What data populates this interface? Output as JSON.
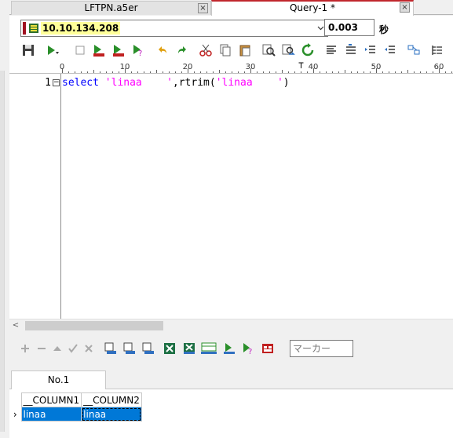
{
  "doc_tabs": [
    {
      "label": "LFTPN.a5er",
      "close": "×"
    },
    {
      "label": "Query-1 *",
      "close": "×"
    }
  ],
  "connection": {
    "address": "10.10.134.208",
    "elapsed": "0.003",
    "elapsed_unit": "秒"
  },
  "ruler": {
    "labels": [
      "0",
      "10",
      "20",
      "30",
      "40",
      "50",
      "60"
    ]
  },
  "editor": {
    "line_number": "1",
    "fold_symbol": "−",
    "tokens": [
      {
        "text": "select",
        "kind": "kw"
      },
      {
        "text": " ",
        "kind": "plain"
      },
      {
        "text": "'linaa    '",
        "kind": "str"
      },
      {
        "text": ",rtrim(",
        "kind": "plain"
      },
      {
        "text": "'linaa    '",
        "kind": "str"
      },
      {
        "text": ")",
        "kind": "plain"
      }
    ]
  },
  "scroll": {
    "left_arrow": "<"
  },
  "grid_toolbar": {
    "marker_placeholder": "マーカー"
  },
  "result_tabs": [
    {
      "label": "No.1"
    }
  ],
  "result_grid": {
    "columns": [
      "__COLUMN1",
      "__COLUMN2"
    ],
    "row_marker": "›",
    "rows": [
      [
        "linaa",
        "linaa"
      ]
    ]
  }
}
